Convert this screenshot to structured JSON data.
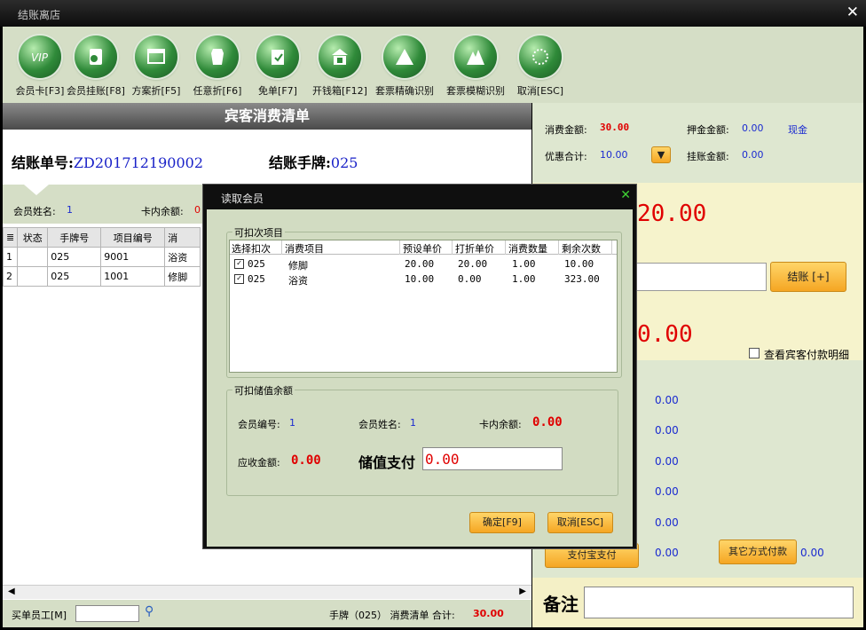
{
  "window": {
    "title": "结账离店"
  },
  "toolbar": [
    {
      "label": "会员卡[F3]",
      "icon": "vip-card-icon"
    },
    {
      "label": "会员挂账[F8]",
      "icon": "member-credit-icon"
    },
    {
      "label": "方案折[F5]",
      "icon": "plan-discount-icon"
    },
    {
      "label": "任意折[F6]",
      "icon": "any-discount-icon"
    },
    {
      "label": "免单[F7]",
      "icon": "free-order-icon"
    },
    {
      "label": "开钱箱[F12]",
      "icon": "cash-drawer-icon"
    },
    {
      "label": "套票精确识别",
      "icon": "ticket-exact-icon"
    },
    {
      "label": "套票模糊识别",
      "icon": "ticket-fuzzy-icon"
    },
    {
      "label": "取消[ESC]",
      "icon": "cancel-icon"
    }
  ],
  "left": {
    "header": "宾客消费清单",
    "bill_no_label": "结账单号:",
    "bill_no": "ZD201712190002",
    "tag_label": "结账手牌:",
    "tag": "025",
    "member_name_label": "会员姓名:",
    "member_name": "1",
    "card_balance_label": "卡内余额:",
    "card_balance_partial": "0",
    "table": {
      "headers": [
        "状态",
        "手牌号",
        "项目编号",
        "消"
      ],
      "rows": [
        [
          "1",
          "",
          "025",
          "9001",
          "浴资"
        ],
        [
          "2",
          "",
          "025",
          "1001",
          "修脚"
        ]
      ]
    },
    "footer": {
      "staff_label": "买单员工[M]",
      "staff_value": "",
      "summary_prefix": "手牌（025） 消费清单 合计:",
      "summary_total": "30.00"
    }
  },
  "right": {
    "consume_label": "消费金额:",
    "consume_value": "30.00",
    "deposit_label": "押金金额:",
    "deposit_value": "0.00",
    "cash_label": "现金",
    "discount_label": "优惠合计:",
    "discount_value": "10.00",
    "credit_label": "挂账金额:",
    "credit_value": "0.00",
    "big_due_partial": "20.00",
    "checkout_button": "结账 [+]",
    "big_change_partial": "0.00",
    "view_payment_detail": "查看宾客付款明细",
    "pay_values": [
      "0.00",
      "0.00",
      "0.00",
      "0.00",
      "0.00",
      "0.00"
    ],
    "alipay_button": "支付宝支付",
    "other_pay_button": "其它方式付款",
    "other_pay_value": "0.00",
    "note_label": "备注",
    "note_value": ""
  },
  "dialog": {
    "title": "读取会员",
    "group1": "可扣次项目",
    "columns": [
      "选择扣次",
      "消费项目",
      "预设单价",
      "打折单价",
      "消费数量",
      "剩余次数"
    ],
    "items": [
      {
        "checked": "✓",
        "code": "025",
        "item": "修脚",
        "preset": "20.00",
        "discount": "20.00",
        "qty": "1.00",
        "remain": "10.00"
      },
      {
        "checked": "✓",
        "code": "025",
        "item": "浴资",
        "preset": "10.00",
        "discount": "0.00",
        "qty": "1.00",
        "remain": "323.00"
      }
    ],
    "group2": "可扣储值余额",
    "member_no_label": "会员编号:",
    "member_no": "1",
    "member_name_label": "会员姓名:",
    "member_name": "1",
    "card_balance_label": "卡内余额:",
    "card_balance": "0.00",
    "receivable_label": "应收金额:",
    "receivable": "0.00",
    "stored_pay_label": "储值支付",
    "stored_pay_value": "0.00",
    "ok_button": "确定[F9]",
    "cancel_button": "取消[ESC]"
  },
  "colors": {
    "accent_red": "#e00000",
    "value_blue": "#1a2ad0",
    "panel_green": "#d5dec6",
    "button_orange": "#f5a623"
  }
}
